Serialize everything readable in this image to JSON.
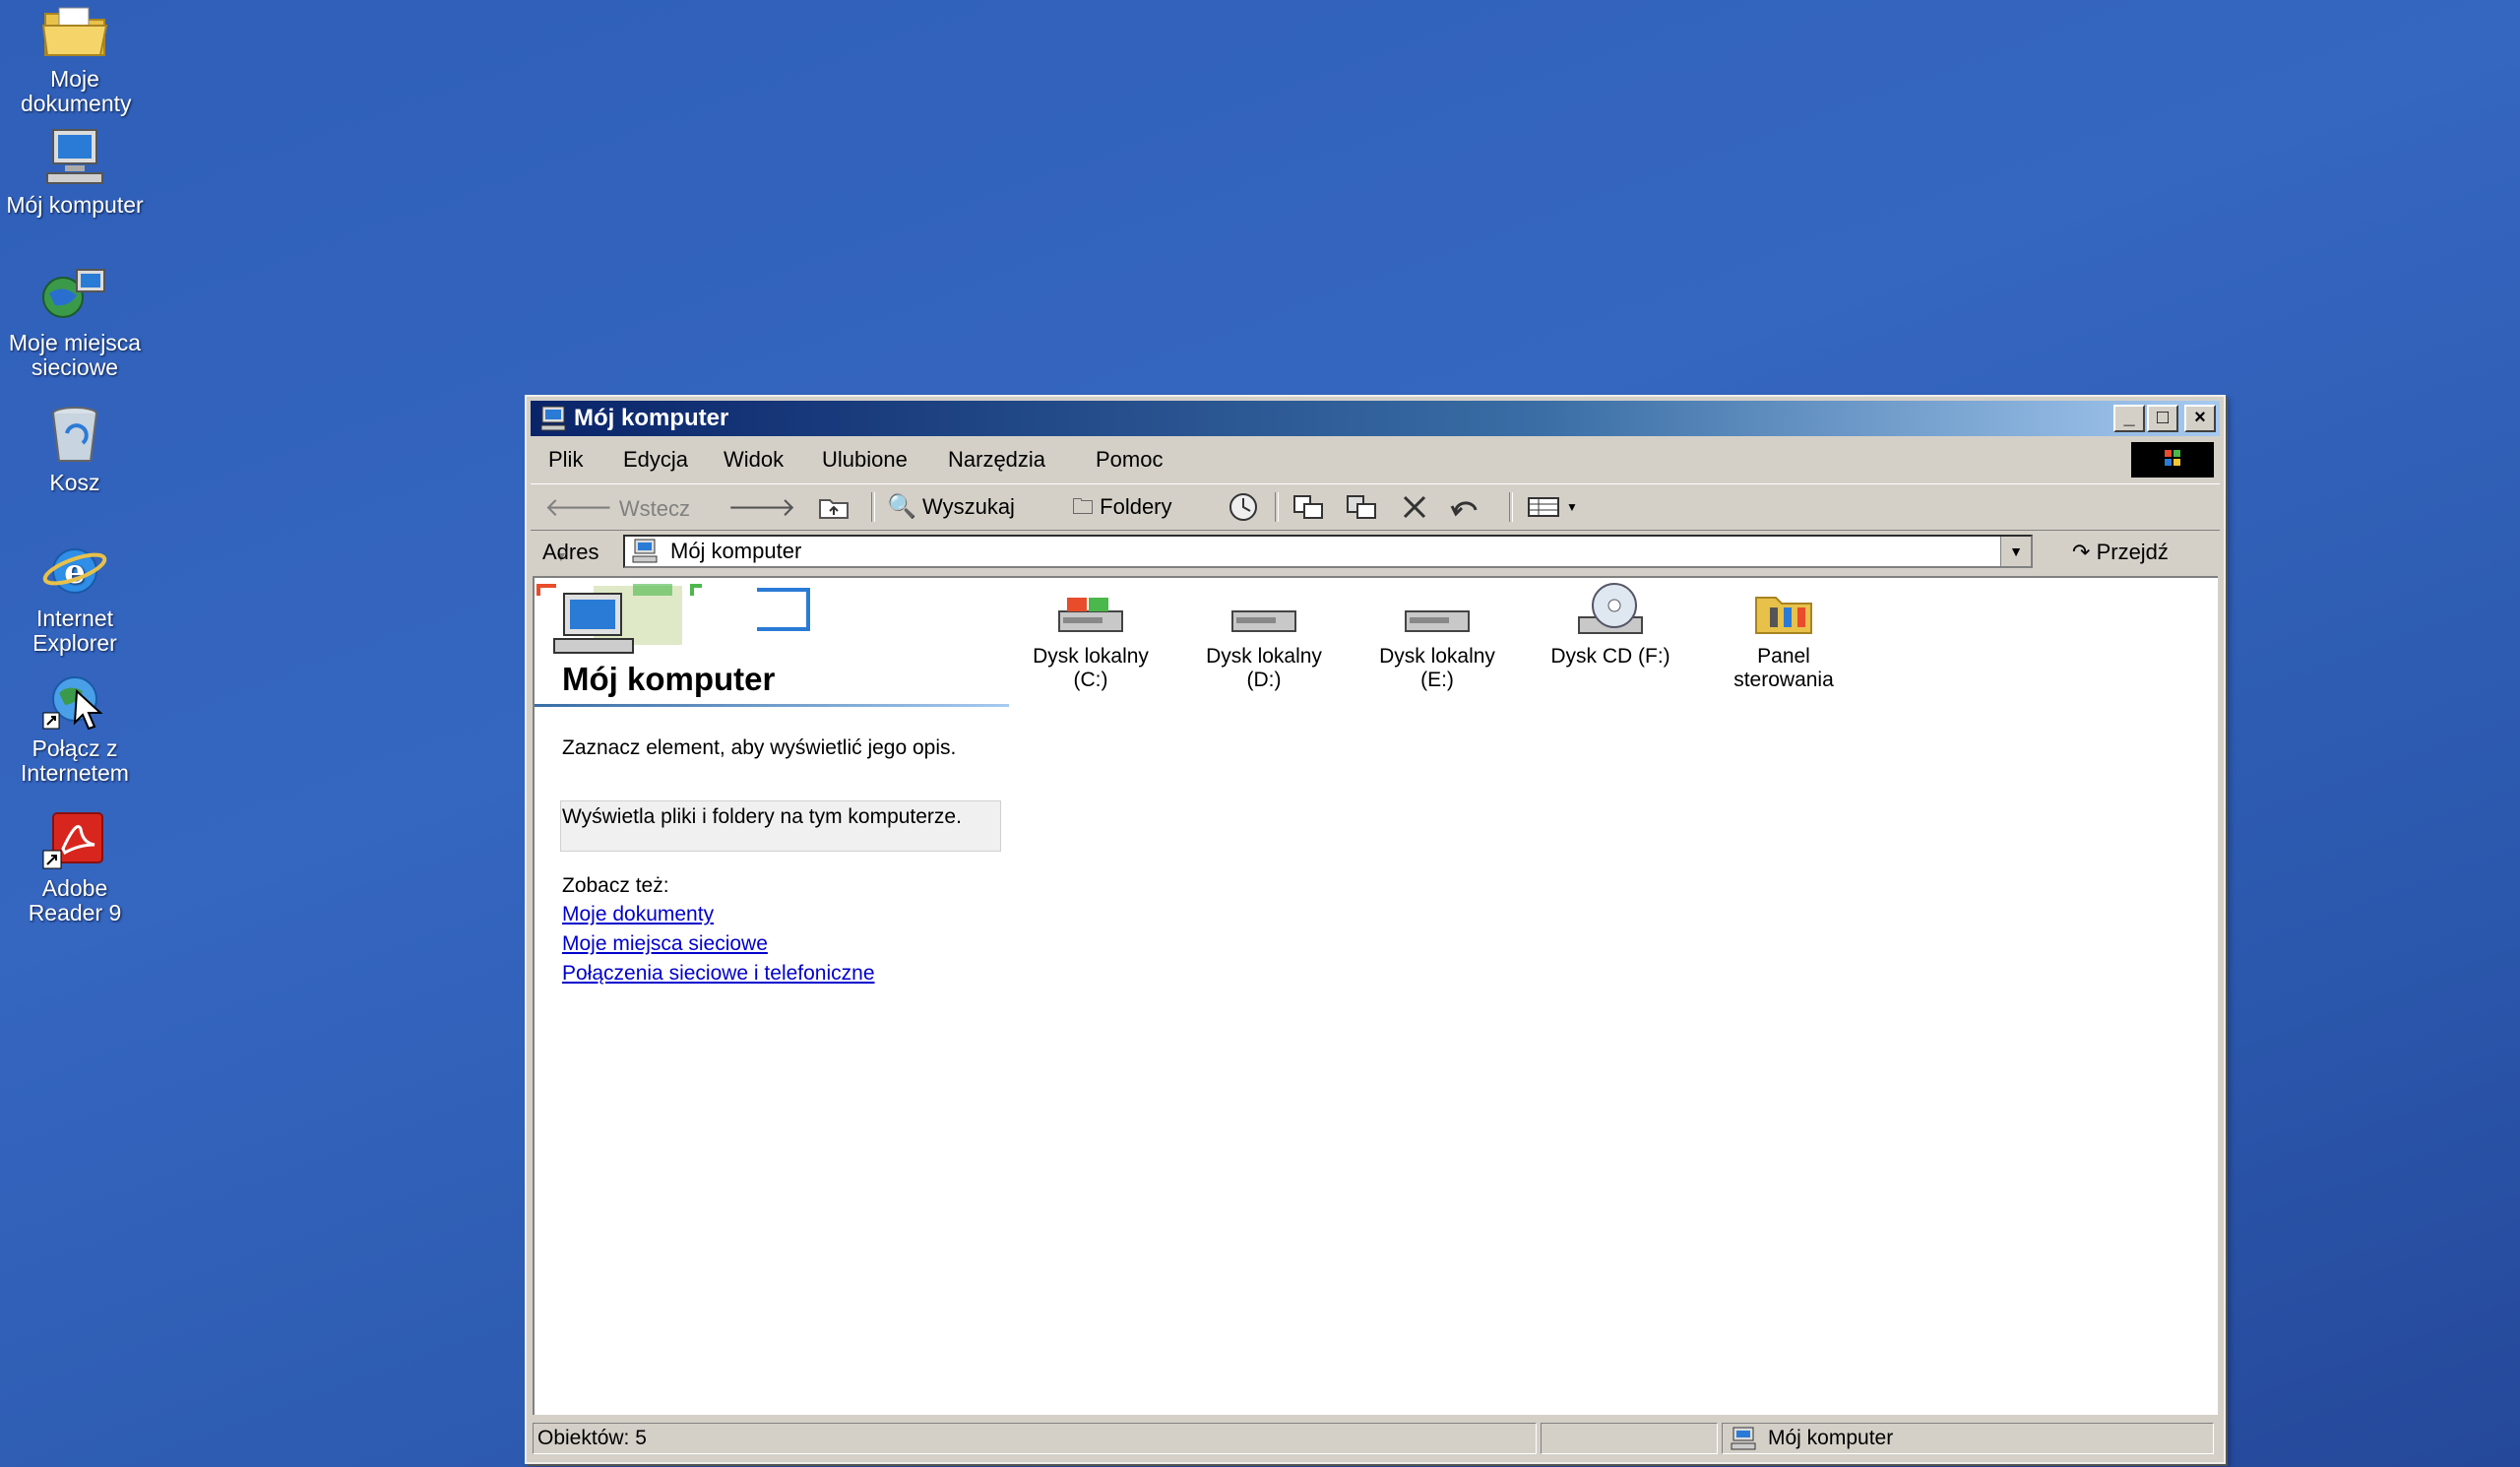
{
  "desktop": {
    "icons": [
      {
        "label": "Moje dokumenty",
        "icon": "folder-documents-icon"
      },
      {
        "label": "Mój komputer",
        "icon": "computer-icon"
      },
      {
        "label": "Moje miejsca sieciowe",
        "icon": "network-places-icon"
      },
      {
        "label": "Kosz",
        "icon": "recycle-bin-icon"
      },
      {
        "label": "Internet Explorer",
        "icon": "internet-explorer-icon"
      },
      {
        "label": "Połącz z Internetem",
        "icon": "connect-internet-icon"
      },
      {
        "label": "Adobe Reader 9",
        "icon": "adobe-reader-icon"
      }
    ]
  },
  "window": {
    "title": "Mój komputer",
    "menu": [
      "Plik",
      "Edycja",
      "Widok",
      "Ulubione",
      "Narzędzia",
      "Pomoc"
    ],
    "toolbar": {
      "back": "Wstecz",
      "search": "Wyszukaj",
      "folders": "Foldery"
    },
    "address": {
      "label": "Adres",
      "value": "Mój komputer",
      "go": "Przejdź"
    },
    "left_pane": {
      "title": "Mój komputer",
      "hint": "Zaznacz element, aby wyświetlić jego opis.",
      "description": "Wyświetla pliki i foldery na tym komputerze.",
      "see_also": "Zobacz też:",
      "links": [
        "Moje dokumenty",
        "Moje miejsca sieciowe",
        "Połączenia sieciowe i telefoniczne"
      ]
    },
    "items": [
      {
        "line1": "Dysk lokalny",
        "line2": "(C:)",
        "icon": "hard-drive-system-icon"
      },
      {
        "line1": "Dysk lokalny",
        "line2": "(D:)",
        "icon": "hard-drive-icon"
      },
      {
        "line1": "Dysk lokalny",
        "line2": "(E:)",
        "icon": "hard-drive-icon"
      },
      {
        "line1": "Dysk CD (F:)",
        "line2": "",
        "icon": "cd-drive-icon"
      },
      {
        "line1": "Panel",
        "line2": "sterowania",
        "icon": "control-panel-icon"
      }
    ],
    "status": {
      "objects": "Obiektów: 5",
      "location": "Mój komputer"
    }
  },
  "colors": {
    "desktop": "#2f5fb8",
    "titlebar_start": "#0a246a",
    "titlebar_end": "#a6caf0",
    "link": "#0000cc",
    "window_face": "#d4d0c8"
  }
}
